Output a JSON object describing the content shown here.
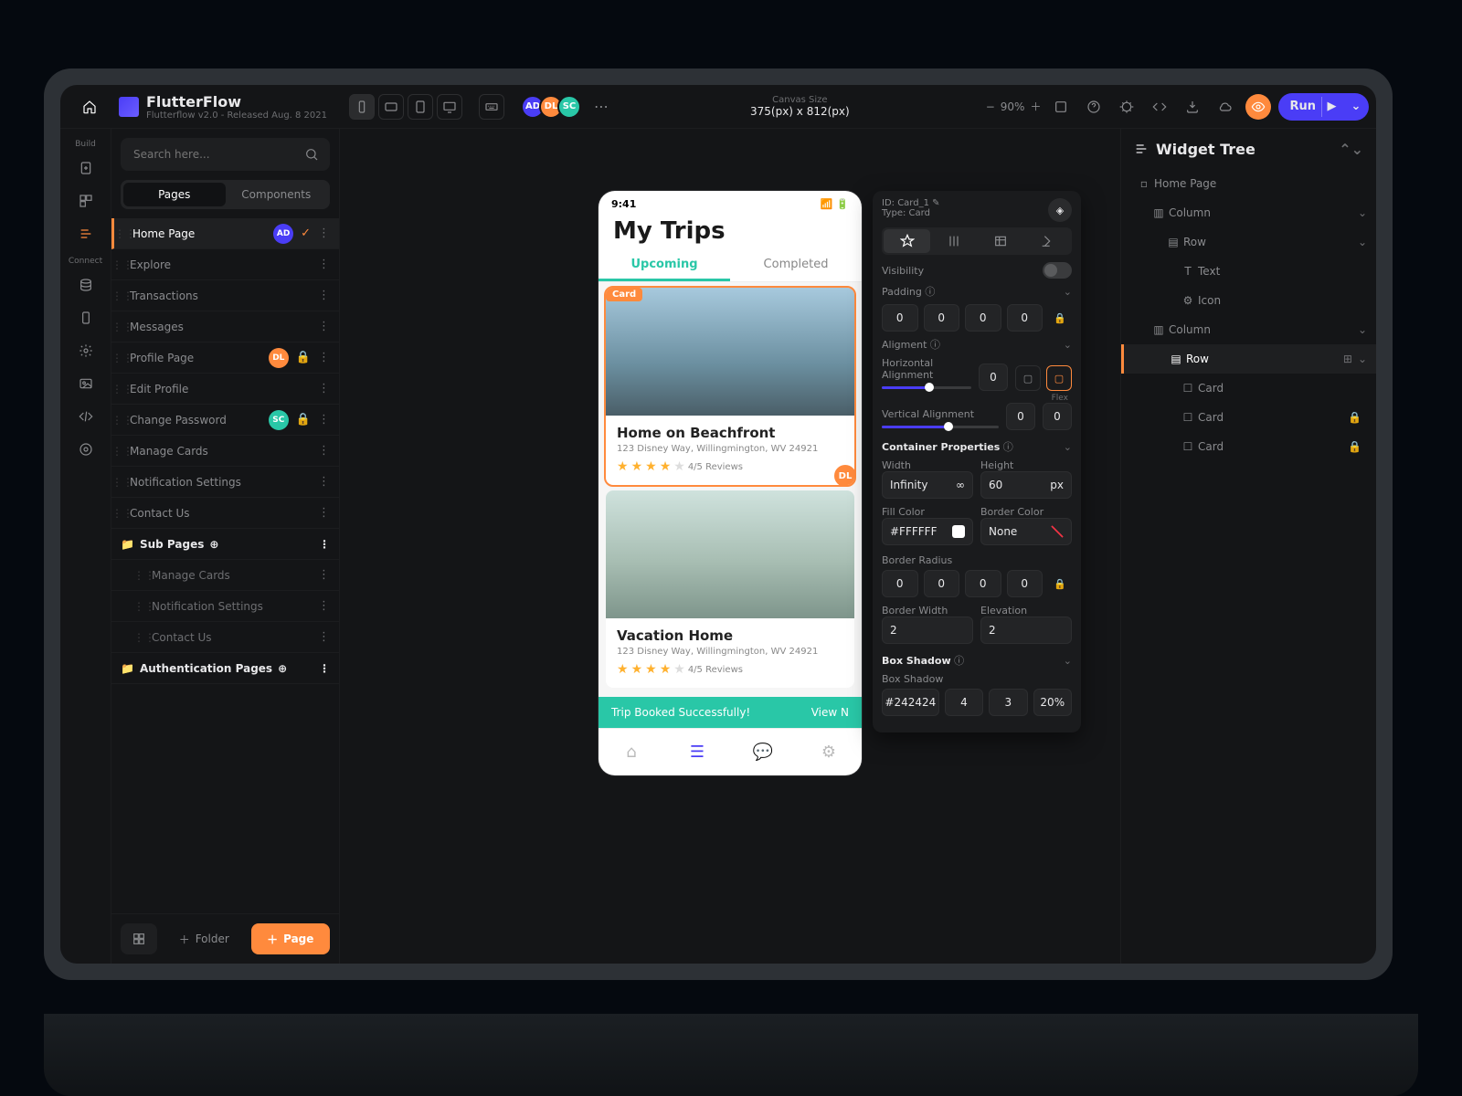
{
  "brand": {
    "name": "FlutterFlow",
    "subtitle": "Flutterflow v2.0 - Released Aug. 8 2021"
  },
  "topbar": {
    "canvasLabel": "Canvas Size",
    "canvasValue": "375(px) x 812(px)",
    "zoom": "90%",
    "run": "Run",
    "avatars": [
      {
        "txt": "AD",
        "color": "#4a3df6"
      },
      {
        "txt": "DL",
        "color": "#ff8a3d"
      },
      {
        "txt": "SC",
        "color": "#29c7a7"
      }
    ]
  },
  "rail": {
    "build": "Build",
    "connect": "Connect"
  },
  "sidebar": {
    "searchPlaceholder": "Search here...",
    "tabs": {
      "pages": "Pages",
      "components": "Components"
    },
    "pages": [
      {
        "label": "Home Page",
        "active": true,
        "chip": {
          "txt": "AD",
          "color": "#4a3df6"
        },
        "check": true
      },
      {
        "label": "Explore"
      },
      {
        "label": "Transactions"
      },
      {
        "label": "Messages"
      },
      {
        "label": "Profile Page",
        "chip": {
          "txt": "DL",
          "color": "#ff8a3d"
        },
        "locked": true
      },
      {
        "label": "Edit Profile"
      },
      {
        "label": "Change Password",
        "chip": {
          "txt": "SC",
          "color": "#29c7a7"
        },
        "locked": true
      },
      {
        "label": "Manage Cards"
      },
      {
        "label": "Notification Settings"
      },
      {
        "label": "Contact Us"
      }
    ],
    "subSection": "Sub Pages",
    "subPages": [
      {
        "label": "Manage Cards"
      },
      {
        "label": "Notification Settings"
      },
      {
        "label": "Contact Us"
      }
    ],
    "authSection": "Authentication Pages",
    "footer": {
      "folder": "Folder",
      "page": "Page"
    }
  },
  "phone": {
    "time": "9:41",
    "title": "My Trips",
    "tabUpcoming": "Upcoming",
    "tabCompleted": "Completed",
    "cardTag": "Card",
    "cards": [
      {
        "title": "Home on Beachfront",
        "addr": "123 Disney Way, Willingmington, WV 24921",
        "reviews": "4/5 Reviews",
        "av": "DL"
      },
      {
        "title": "Vacation Home",
        "addr": "123 Disney Way, Willingmington, WV 24921",
        "reviews": "4/5 Reviews"
      }
    ],
    "toast": {
      "msg": "Trip Booked Successfully!",
      "action": "View N"
    }
  },
  "inspector": {
    "id": "ID: Card_1",
    "type": "Type: Card",
    "visibility": "Visibility",
    "padding": "Padding",
    "pad": [
      "0",
      "0",
      "0",
      "0"
    ],
    "alignment": "Aligment",
    "horiz": "Horizontal Alignment",
    "vert": "Vertical Alignment",
    "horizVal": "0",
    "vertVals": [
      "0",
      "0"
    ],
    "flex": "Flex",
    "container": "Container Properties",
    "width": "Width",
    "height": "Height",
    "widthVal": "Infinity",
    "heightVal": "60",
    "px": "px",
    "fill": "Fill Color",
    "border": "Border Color",
    "fillVal": "#FFFFFF",
    "borderVal": "None",
    "radius": "Border Radius",
    "rad": [
      "0",
      "0",
      "0",
      "0"
    ],
    "bw": "Border Width",
    "bwVal": "2",
    "elev": "Elevation",
    "elevVal": "2",
    "shadow": "Box Shadow",
    "shadowLbl": "Box Shadow",
    "shadowVals": [
      "#242424",
      "4",
      "3",
      "20%"
    ]
  },
  "tree": {
    "title": "Widget Tree",
    "nodes": [
      {
        "icon": "page",
        "label": "Home Page",
        "d": 1
      },
      {
        "icon": "col",
        "label": "Column",
        "d": 2,
        "exp": true
      },
      {
        "icon": "row",
        "label": "Row",
        "d": 3,
        "exp": true
      },
      {
        "icon": "text",
        "label": "Text",
        "d": 4
      },
      {
        "icon": "icon",
        "label": "Icon",
        "d": 4
      },
      {
        "icon": "col",
        "label": "Column",
        "d": 2,
        "exp": true
      },
      {
        "icon": "row",
        "label": "Row",
        "d": 3,
        "active": true,
        "badge": true,
        "exp": true
      },
      {
        "icon": "card",
        "label": "Card",
        "d": 4
      },
      {
        "icon": "card",
        "label": "Card",
        "d": 4,
        "locked": true
      },
      {
        "icon": "card",
        "label": "Card",
        "d": 4,
        "locked": true
      }
    ]
  }
}
